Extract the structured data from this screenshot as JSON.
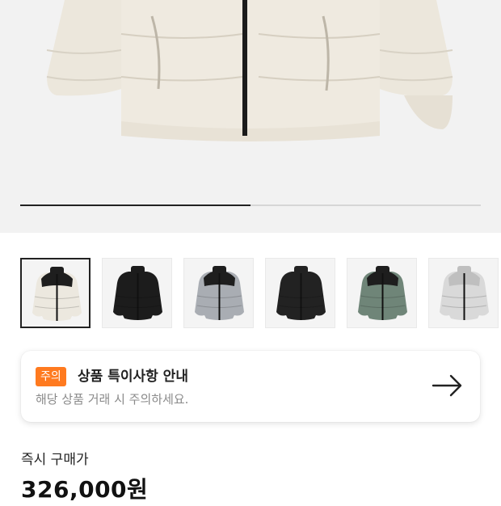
{
  "product": {
    "gallery": {
      "progress": 0.5,
      "thumbnails": [
        {
          "name": "thumb-ivory-black",
          "color": "#ece8df",
          "accent": "#1e1e1e",
          "selected": true
        },
        {
          "name": "thumb-black-gloss",
          "color": "#1c1c1c",
          "accent": "#1c1c1c",
          "selected": false
        },
        {
          "name": "thumb-grey-black",
          "color": "#a9adb3",
          "accent": "#1e1e1e",
          "selected": false
        },
        {
          "name": "thumb-black-matte",
          "color": "#222222",
          "accent": "#222222",
          "selected": false
        },
        {
          "name": "thumb-green-black",
          "color": "#6f8578",
          "accent": "#1e1e1e",
          "selected": false
        },
        {
          "name": "thumb-white-camo",
          "color": "#d9d9d9",
          "accent": "#bfbfbf",
          "selected": false
        }
      ]
    },
    "notice": {
      "badge": "주의",
      "title": "상품 특이사항 안내",
      "subtitle": "해당 상품 거래 시 주의하세요.",
      "icon": "arrow-right-icon"
    },
    "price": {
      "label": "즉시 구매가",
      "value": "326,000원"
    }
  },
  "colors": {
    "badge": "#ff7a1f",
    "hero_background": "#f2f2f2",
    "text_secondary": "#8a8a8a"
  }
}
